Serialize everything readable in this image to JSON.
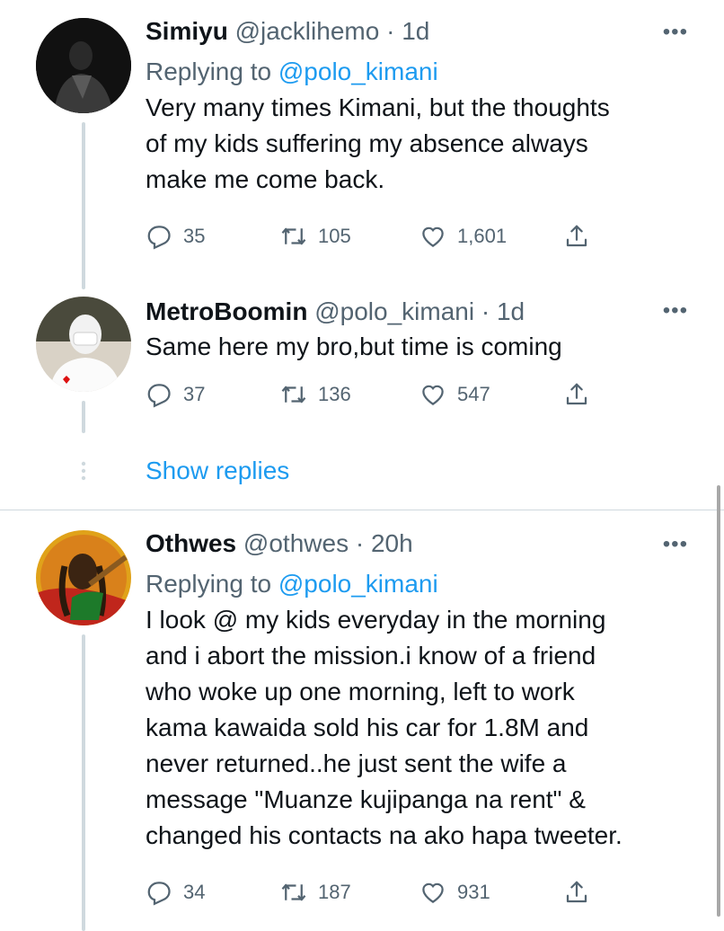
{
  "tweets": [
    {
      "name": "Simiyu",
      "handle": "@jacklihemo",
      "time": "1d",
      "replying_prefix": "Replying to",
      "replying_to": "@polo_kimani",
      "lines": [
        "Very many times Kimani, but the thoughts",
        "of my kids suffering my absence always",
        "make me come back."
      ],
      "replies": "35",
      "retweets": "105",
      "likes": "1,601"
    },
    {
      "name": "MetroBoomin",
      "handle": "@polo_kimani",
      "time": "1d",
      "lines": [
        "Same here my bro,but time is coming"
      ],
      "replies": "37",
      "retweets": "136",
      "likes": "547"
    },
    {
      "name": "Othwes",
      "handle": "@othwes",
      "time": "20h",
      "replying_prefix": "Replying to",
      "replying_to": "@polo_kimani",
      "lines": [
        "I look @ my kids everyday in the morning",
        "and i abort the mission.i know of a friend",
        "who woke up one morning, left to work",
        "kama kawaida sold his car for 1.8M and",
        "never returned..he just sent the wife a",
        "message \"Muanze kujipanga na rent\" &",
        "changed his contacts na ako hapa tweeter."
      ],
      "replies": "34",
      "retweets": "187",
      "likes": "931"
    }
  ],
  "show_replies": "Show replies",
  "separator": "·",
  "more": "•••",
  "colors": {
    "link": "#1d9bf0",
    "secondary": "#536471",
    "line": "#cfd9de"
  }
}
